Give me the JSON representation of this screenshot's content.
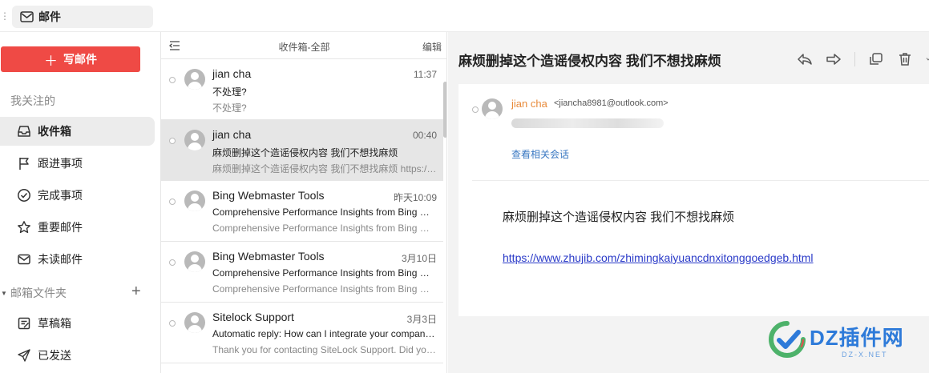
{
  "app": {
    "tab_title": "邮件"
  },
  "sidebar": {
    "compose_label": "写邮件",
    "favorites_label": "我关注的",
    "items": [
      {
        "label": "收件箱",
        "icon": "inbox-icon"
      },
      {
        "label": "跟进事项",
        "icon": "flag-icon"
      },
      {
        "label": "完成事项",
        "icon": "check-circle-icon"
      },
      {
        "label": "重要邮件",
        "icon": "star-icon"
      },
      {
        "label": "未读邮件",
        "icon": "mail-icon"
      }
    ],
    "folders_label": "邮箱文件夹",
    "folder_items": [
      {
        "label": "草稿箱",
        "icon": "draft-icon"
      },
      {
        "label": "已发送",
        "icon": "send-icon"
      }
    ]
  },
  "maillist": {
    "title": "收件箱-全部",
    "edit_label": "编辑",
    "items": [
      {
        "sender": "jian cha",
        "time": "11:37",
        "subject": "不处理?",
        "preview": "不处理?"
      },
      {
        "sender": "jian cha",
        "time": "00:40",
        "subject": "麻烦删掉这个造谣侵权内容 我们不想找麻烦",
        "preview": "麻烦删掉这个造谣侵权内容 我们不想找麻烦 https://www.zhujib.com/zhimingkaiyuancdnxitonggoedgeb.html"
      },
      {
        "sender": "Bing Webmaster Tools",
        "time": "昨天10:09",
        "subject": "Comprehensive Performance Insights from Bing Webmaster Tools",
        "preview": "Comprehensive Performance Insights from Bing Webmaster Tools"
      },
      {
        "sender": "Bing Webmaster Tools",
        "time": "3月10日",
        "subject": "Comprehensive Performance Insights from Bing Webmaster Tools",
        "preview": "Comprehensive Performance Insights from Bing Webmaster Tools"
      },
      {
        "sender": "Sitelock Support",
        "time": "3月3日",
        "subject": "Automatic reply: How can I integrate your company's services",
        "preview": "Thank you for contacting SiteLock Support. Did you know"
      }
    ]
  },
  "reader": {
    "subject": "麻烦删掉这个造谣侵权内容 我们不想找麻烦",
    "from_name": "jian cha",
    "from_addr": "<jiancha8981@outlook.com>",
    "related_link": "查看相关会话",
    "body_text": "麻烦删掉这个造谣侵权内容  我们不想找麻烦",
    "body_link": "https://www.zhujib.com/zhimingkaiyuancdnxitonggoedgeb.html"
  },
  "watermark": {
    "text": "DZ插件网",
    "sub": "DZ-X.NET"
  },
  "colors": {
    "accent": "#ef4a45",
    "link": "#2a3ac8",
    "sender_highlight": "#e88a3a"
  }
}
